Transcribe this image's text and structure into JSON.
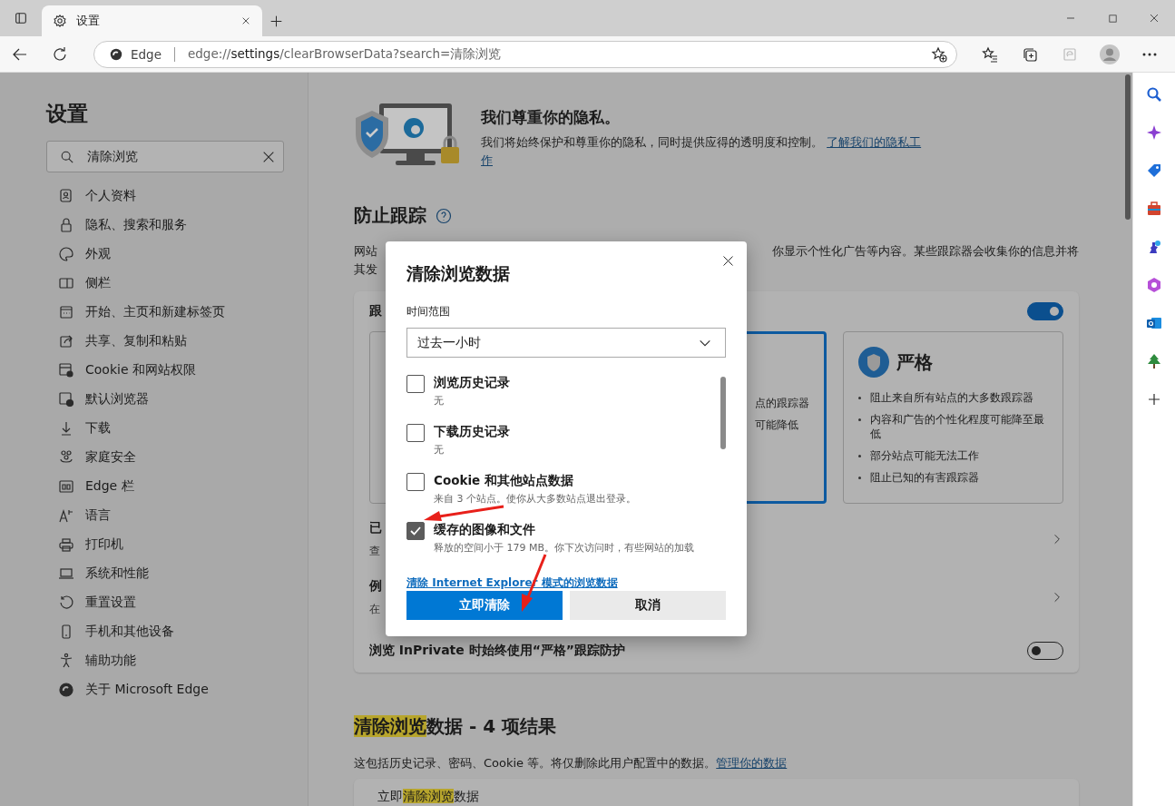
{
  "browser": {
    "tab": {
      "title": "设置",
      "selected": true
    },
    "address": {
      "site_label": "Edge",
      "url_scheme": "edge://",
      "url_page": "settings",
      "url_rest": "/clearBrowserData?search=清除浏览"
    }
  },
  "sidebar": {
    "title": "设置",
    "search": {
      "value": "清除浏览"
    },
    "items": [
      {
        "label": "个人资料"
      },
      {
        "label": "隐私、搜索和服务"
      },
      {
        "label": "外观"
      },
      {
        "label": "侧栏"
      },
      {
        "label": "开始、主页和新建标签页"
      },
      {
        "label": "共享、复制和粘贴"
      },
      {
        "label": "Cookie 和网站权限"
      },
      {
        "label": "默认浏览器"
      },
      {
        "label": "下载"
      },
      {
        "label": "家庭安全"
      },
      {
        "label": "Edge 栏"
      },
      {
        "label": "语言"
      },
      {
        "label": "打印机"
      },
      {
        "label": "系统和性能"
      },
      {
        "label": "重置设置"
      },
      {
        "label": "手机和其他设备"
      },
      {
        "label": "辅助功能"
      },
      {
        "label": "关于 Microsoft Edge"
      }
    ]
  },
  "privacy": {
    "title": "我们尊重你的隐私。",
    "text": "我们将始终保护和尊重你的隐私，同时提供应得的透明度和控制。",
    "link_lines": [
      "了解我们的隐私工",
      "作"
    ]
  },
  "tracking": {
    "title": "防止跟踪",
    "intro_left": [
      "网站",
      "其发"
    ],
    "intro_right": "你显示个性化广告等内容。某些跟踪器会收集你的信息并将",
    "toggle_label": "跟",
    "toggle_on": true,
    "levels": [
      {
        "selected": false
      },
      {
        "selected": true,
        "lines": [
          "点的跟踪器",
          "可能降低"
        ]
      },
      {
        "selected": false,
        "title": "严格",
        "bullets": [
          "阻止来自所有站点的大多数跟踪器",
          "内容和广告的个性化程度可能降至最低",
          "部分站点可能无法工作",
          "阻止已知的有害跟踪器"
        ]
      }
    ],
    "rows": [
      {
        "label": "已",
        "sub": "查"
      },
      {
        "label": "例",
        "sub": "在"
      }
    ],
    "inprivate": {
      "label": "浏览 InPrivate 时始终使用“严格”跟踪防护",
      "on": false
    }
  },
  "clear_section": {
    "heading_highlight": "清除浏览",
    "heading_rest": "数据 - 4 项结果",
    "text": "这包括历史记录、密码、Cookie 等。将仅删除此用户配置中的数据。",
    "link": "管理你的数据",
    "card_title": [
      "立即",
      "清除浏览",
      "数据"
    ]
  },
  "dialog": {
    "title": "清除浏览数据",
    "range_label": "时间范围",
    "range_value": "过去一小时",
    "items": [
      {
        "label": "浏览历史记录",
        "detail": "无",
        "checked": false
      },
      {
        "label": "下载历史记录",
        "detail": "无",
        "checked": false
      },
      {
        "label": "Cookie 和其他站点数据",
        "detail": "来自 3 个站点。使你从大多数站点退出登录。",
        "checked": false
      },
      {
        "label": "缓存的图像和文件",
        "detail": "释放的空间小于 179 MB。你下次访问时，有些网站的加载",
        "checked": true
      }
    ],
    "ie_link": "清除 Internet Explorer 模式的浏览数据",
    "primary": "立即清除",
    "secondary": "取消"
  }
}
